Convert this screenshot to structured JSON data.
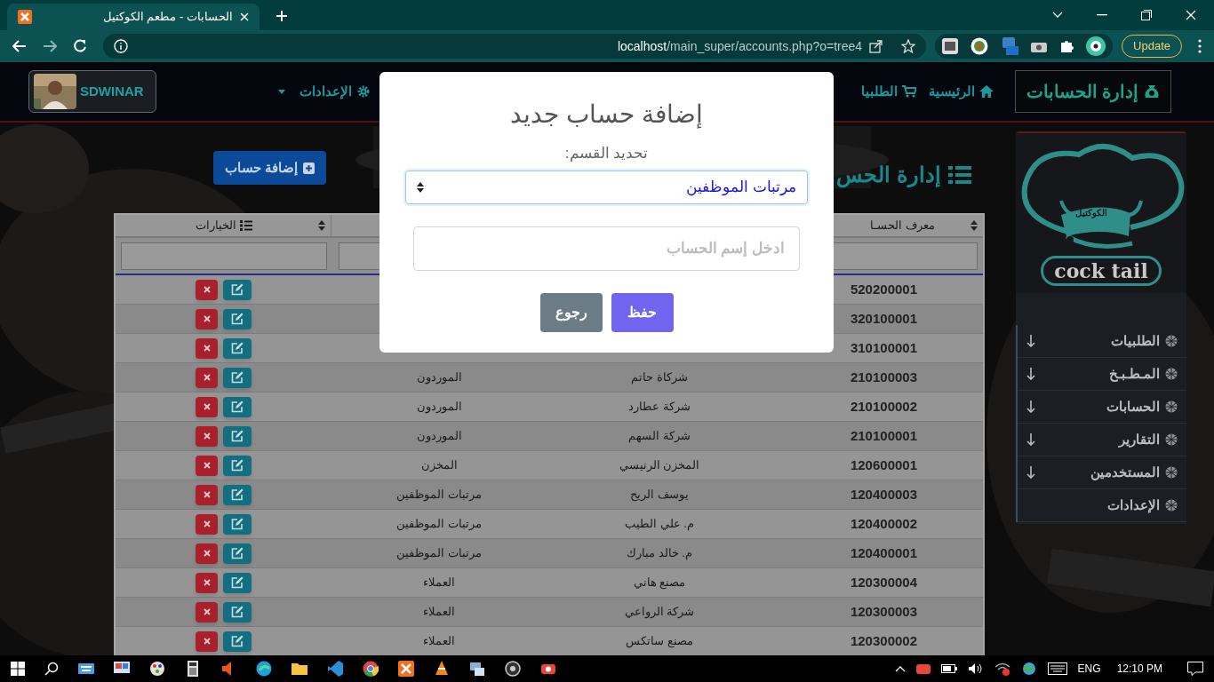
{
  "browser": {
    "tab": {
      "title": "الحسابات - مطعم الكوكتيل",
      "selected": true
    },
    "address": {
      "host": "localhost",
      "path": "/main_super/accounts.php?o=tree4"
    },
    "update_button": "Update"
  },
  "navbar": {
    "brand": "إدارة الحسابات",
    "links": [
      {
        "label": "الرئيسية",
        "kind": "home"
      },
      {
        "label": "الطلبيا",
        "kind": "cart"
      }
    ],
    "settings": "الإعدادات",
    "user": "SDWINAR"
  },
  "page": {
    "heading": "إدارة الحس",
    "add_button": "إضافة حساب"
  },
  "table": {
    "id_header": "معرف الحسـا",
    "options_header": "الخيارات",
    "rows": [
      {
        "id": "520200001"
      },
      {
        "id": "320100001"
      },
      {
        "id": "310100001"
      },
      {
        "id": "210100003",
        "name": "شركاة حاتم",
        "section": "الموردون"
      },
      {
        "id": "210100002",
        "name": "شركة عطارد",
        "section": "الموردون"
      },
      {
        "id": "210100001",
        "name": "شركة السهم",
        "section": "الموردون"
      },
      {
        "id": "120600001",
        "name": "المخزن الرنيسي",
        "section": "المخزن"
      },
      {
        "id": "120400003",
        "name": "يوسف الريح",
        "section": "مرتبات الموظفين"
      },
      {
        "id": "120400002",
        "name": "م. علي الطيب",
        "section": "مرتبات الموظفين"
      },
      {
        "id": "120400001",
        "name": "م. خالد مبارك",
        "section": "مرتبات الموظفين"
      },
      {
        "id": "120300004",
        "name": "مصنع هاني",
        "section": "العملاء"
      },
      {
        "id": "120300003",
        "name": "شركة الرواعي",
        "section": "العملاء"
      },
      {
        "id": "120300002",
        "name": "مصنع ساتكس",
        "section": "العملاء"
      }
    ]
  },
  "sidebar": {
    "logo": {
      "arabic": "الكوكتيل",
      "latin": "cock tail"
    },
    "items": [
      {
        "label": "الطلبيات",
        "expandable": true
      },
      {
        "label": "المـطـبـخ",
        "expandable": true
      },
      {
        "label": "الحسابات",
        "expandable": true
      },
      {
        "label": "التقارير",
        "expandable": true
      },
      {
        "label": "المستخدمين",
        "expandable": true
      },
      {
        "label": "الإعدادات",
        "expandable": false
      }
    ]
  },
  "modal": {
    "title": "إضافة حساب جديد",
    "select_label": "تحديد القسم:",
    "select_value": "مرتبات الموظفين",
    "name_placeholder": "ادخل إسم الحساب",
    "buttons": [
      {
        "label": "حفظ",
        "kind": "primary"
      },
      {
        "label": "رجوع",
        "kind": "secondary"
      }
    ]
  },
  "taskbar": {
    "language": "ENG",
    "time": "12:10 PM"
  }
}
